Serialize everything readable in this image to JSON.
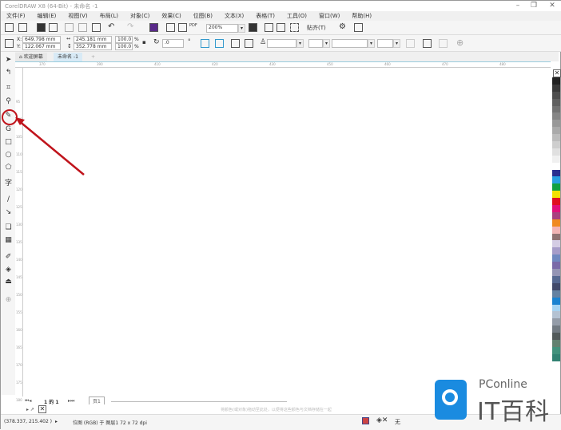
{
  "window": {
    "title": "CorelDRAW X8 (64-Bit) - 未命名 -1"
  },
  "menu": [
    "文件(F)",
    "编辑(E)",
    "视图(V)",
    "布局(L)",
    "对象(C)",
    "效果(C)",
    "位图(B)",
    "文本(X)",
    "表格(T)",
    "工具(O)",
    "窗口(W)",
    "帮助(H)"
  ],
  "toolbar": {
    "zoom": "200%",
    "snap": "贴齐(T)"
  },
  "property_bar": {
    "x": "649.798 mm",
    "y": "122.067 mm",
    "width": "245.181 mm",
    "height": "352.778 mm",
    "scale_x": "100.0",
    "scale_y": "100.0",
    "pct": "%",
    "rotation": ".0"
  },
  "tabs": {
    "welcome": "欢迎屏幕",
    "doc": "未命名 -1"
  },
  "ruler": {
    "h": [
      "370",
      "390",
      "410",
      "420",
      "430",
      "450",
      "460",
      "470",
      "480"
    ],
    "v": [
      "95",
      "100",
      "105",
      "110",
      "115",
      "120",
      "125",
      "130",
      "135",
      "140",
      "145",
      "150",
      "155",
      "160",
      "165",
      "170",
      "175",
      "180"
    ]
  },
  "page_nav": {
    "current": "1",
    "of": "的",
    "total": "1",
    "page_tab": "页1"
  },
  "hint": "将颜色(或对象)拖动至此处，以便将这些颜色与文档存储在一起",
  "status": {
    "coords": "(378.337, 215.402 )",
    "info": "位图 (RGB) 于 图层1 72 x 72 dpi",
    "fill": "无"
  },
  "watermark": {
    "brand": "PConline",
    "name": "IT百科"
  },
  "palette": [
    "#222222",
    "#3a3a3a",
    "#4e4e4e",
    "#606060",
    "#727272",
    "#858585",
    "#989898",
    "#aaaaaa",
    "#bcbcbc",
    "#cecece",
    "#e0e0e0",
    "#f0f0f0",
    "#ffffff",
    "#2a2f8f",
    "#2a9fe0",
    "#12a040",
    "#f2e200",
    "#e01020",
    "#e0107a",
    "#a84080",
    "#f08a20",
    "#f2b4b4",
    "#907272",
    "#d4cce4",
    "#a69cc9",
    "#7088c0",
    "#7a6aa8",
    "#9494b4",
    "#566890",
    "#424a6a",
    "#6482a2",
    "#1a82d0",
    "#a6d4f2",
    "#b4c2d2",
    "#949ca8",
    "#727a82",
    "#525a5a",
    "#628270",
    "#42927c",
    "#328272"
  ],
  "annotation_color": "#c0141c"
}
